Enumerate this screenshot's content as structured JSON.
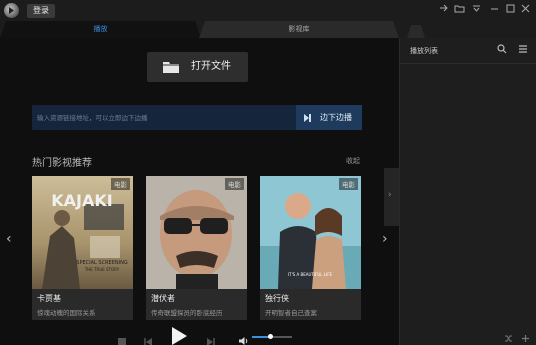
{
  "titlebar": {
    "login_label": "登录",
    "window_icons": [
      "pin-icon",
      "folder-icon",
      "menu-down-icon",
      "minimize-icon",
      "maximize-icon",
      "close-icon"
    ]
  },
  "tabs": [
    {
      "label": "播放",
      "active": true
    },
    {
      "label": "影视库",
      "active": false
    }
  ],
  "main": {
    "open_file_label": "打开文件",
    "url_placeholder": "输入资源链接地址，可以立即边下边播",
    "play_while_downloading_label": "边下边播",
    "section_title": "热门影视推荐",
    "collapse_label": "收起",
    "cards": [
      {
        "badge": "电影",
        "title": "卡贾基",
        "desc": "惊魂动魄的国际关系"
      },
      {
        "badge": "电影",
        "title": "潜伏者",
        "desc": "传奇联盟探员的卧底经历"
      },
      {
        "badge": "电影",
        "title": "独行侠",
        "desc": "开明智者自己查案"
      }
    ],
    "poster_text": {
      "card1_title": "KAJAKI",
      "card1_lines": [
        "SPECIAL SCREENING",
        "THE TRUE STORY"
      ],
      "card3_line": "IT'S A BEAUTIFUL LIFE"
    }
  },
  "player": {
    "volume": 0.45
  },
  "sidebar": {
    "title": "播放列表"
  },
  "colors": {
    "accent": "#3d8fe0",
    "url_bar": "#15263c",
    "sidebar_bg": "#1e1e1e"
  }
}
